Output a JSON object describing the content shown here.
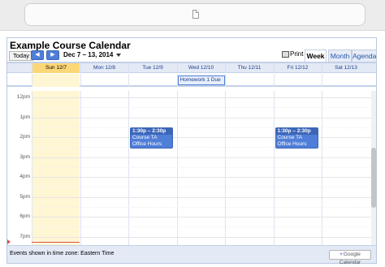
{
  "calendar": {
    "title": "Example Course Calendar",
    "today_label": "Today",
    "prev_icon": "◀",
    "next_icon": "▶",
    "date_range": "Dec 7 – 13, 2014",
    "print_label": "Print",
    "tabs": {
      "week": "Week",
      "month": "Month",
      "agenda": "Agenda"
    },
    "days": [
      {
        "label": "Sun 12/7",
        "today": true
      },
      {
        "label": "Mon 12/8",
        "today": false
      },
      {
        "label": "Tue 12/9",
        "today": false
      },
      {
        "label": "Wed 12/10",
        "today": false
      },
      {
        "label": "Thu 12/11",
        "today": false
      },
      {
        "label": "Fri 12/12",
        "today": false
      },
      {
        "label": "Sat 12/13",
        "today": false
      }
    ],
    "all_day_event": {
      "title": "Homework 1 Due",
      "day": "Wed 12/10"
    },
    "time_labels": [
      "12pm",
      "1pm",
      "2pm",
      "3pm",
      "4pm",
      "5pm",
      "6pm",
      "7pm"
    ],
    "events": [
      {
        "time": "1:30p – 2:30p",
        "title": "Course TA Office Hours",
        "day": "Tue 12/9"
      },
      {
        "time": "1:30p – 2:30p",
        "title": "Course TA Office Hours",
        "day": "Fri 12/12"
      }
    ],
    "footer": {
      "timezone_text": "Events shown in time zone: Eastern Time",
      "badge_text": "Google Calendar",
      "badge_plus": "+"
    }
  }
}
